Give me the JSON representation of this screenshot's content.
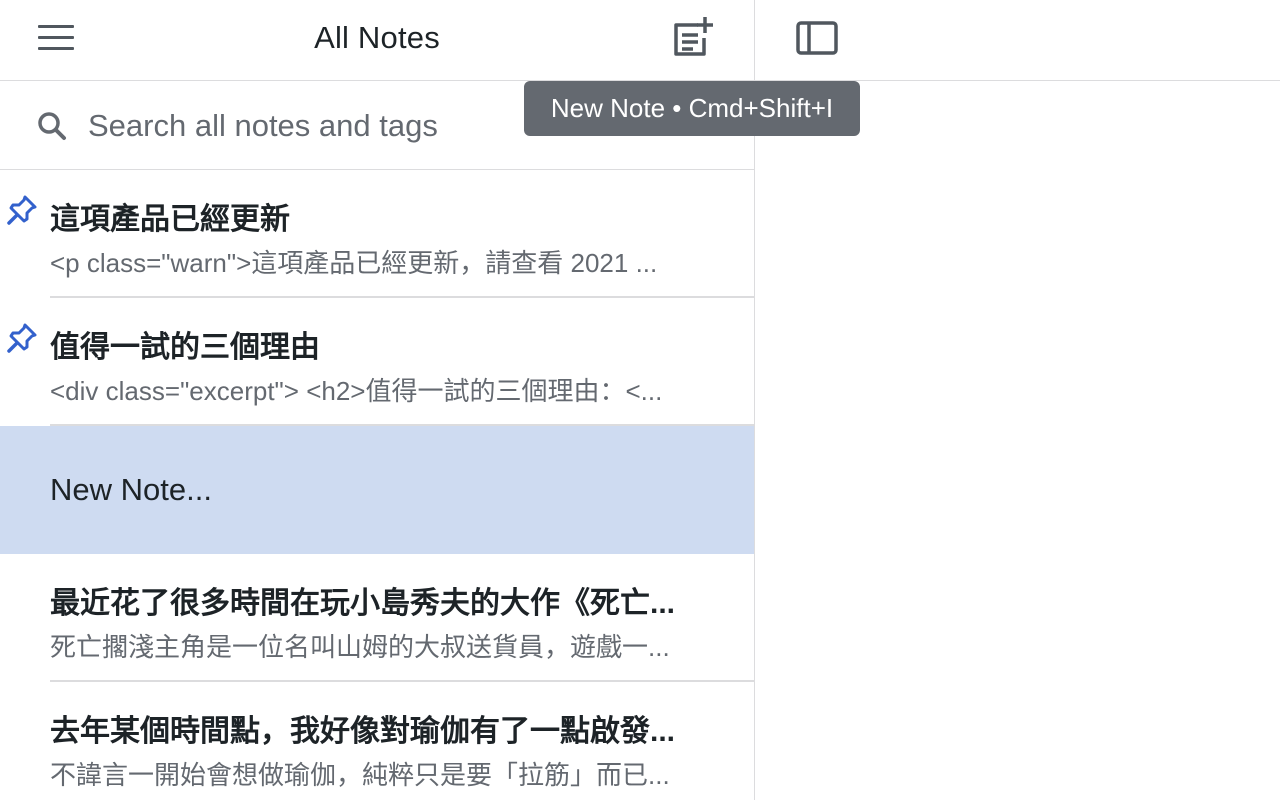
{
  "list": {
    "title": "All Notes",
    "menu_icon": "hamburger-menu-icon",
    "new_note_icon": "new-note-icon"
  },
  "search": {
    "placeholder": "Search all notes and tags",
    "value": ""
  },
  "tooltip": {
    "text": "New Note • Cmd+Shift+I"
  },
  "notes": [
    {
      "title": "這項產品已經更新",
      "excerpt": "<p class=\"warn\">這項產品已經更新，請查看 2021 ...",
      "pinned": true,
      "selected": false
    },
    {
      "title": "值得一試的三個理由",
      "excerpt": "<div class=\"excerpt\"> <h2>值得一試的三個理由：<...",
      "pinned": true,
      "selected": false
    },
    {
      "title": "New Note...",
      "excerpt": "",
      "pinned": false,
      "selected": true
    },
    {
      "title": "最近花了很多時間在玩小島秀夫的大作《死亡...",
      "excerpt": "死亡擱淺主角是一位名叫山姆的大叔送貨員，遊戲一...",
      "pinned": false,
      "selected": false
    },
    {
      "title": "去年某個時間點，我好像對瑜伽有了一點啟發...",
      "excerpt": "不諱言一開始會想做瑜伽，純粹只是要「拉筋」而已...",
      "pinned": false,
      "selected": false
    }
  ],
  "editor": {
    "sidebar_toggle_icon": "sidebar-toggle-icon"
  },
  "colors": {
    "selected_row": "#cedbf1",
    "pin": "#3361cc",
    "tooltip_bg": "#646970",
    "divider": "#dcdcde"
  }
}
